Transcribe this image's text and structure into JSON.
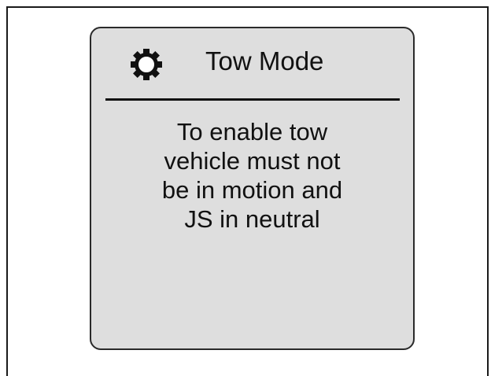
{
  "screen": {
    "icon": "gear-icon",
    "title": "Tow Mode",
    "message_lines": [
      "To enable tow",
      "vehicle must not",
      "be in motion and",
      "JS in neutral"
    ]
  },
  "colors": {
    "panel_background": "#dedede",
    "text": "#111111",
    "border": "#2a2a2a"
  }
}
